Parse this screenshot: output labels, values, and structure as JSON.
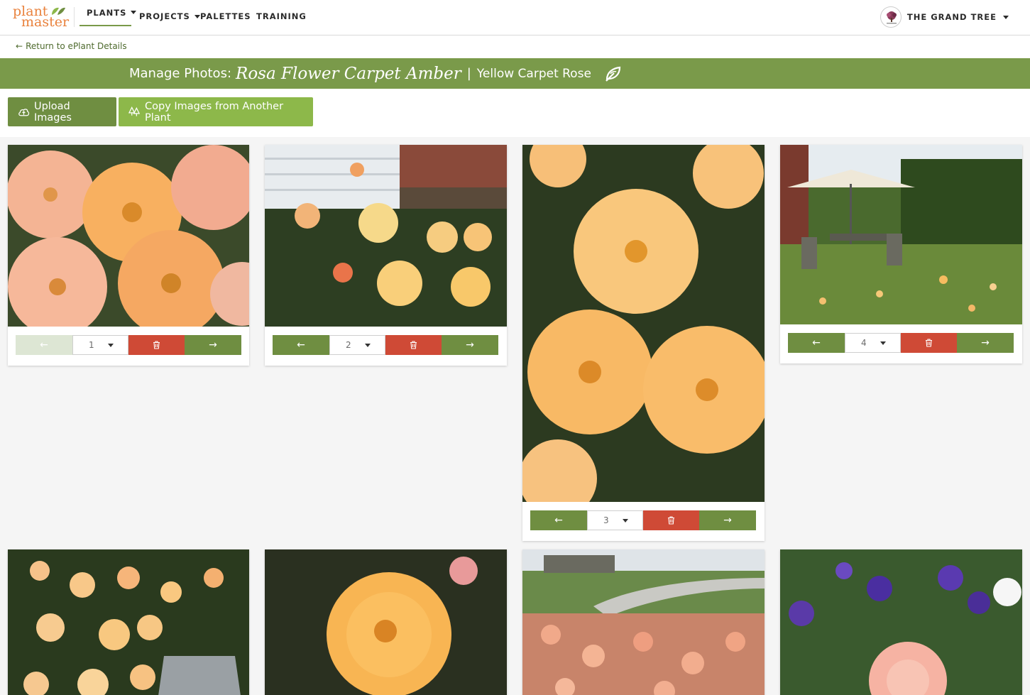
{
  "app": {
    "logo_line1": "plant",
    "logo_line2": "master"
  },
  "nav": {
    "items": [
      {
        "label": "PLANTS"
      },
      {
        "label": "PROJECTS"
      },
      {
        "label": "PALETTES"
      },
      {
        "label": "TRAINING"
      }
    ],
    "account_name": "THE GRAND TREE"
  },
  "back_link": "Return to ePlant Details",
  "header": {
    "prefix": "Manage Photos:",
    "botanical_name": "Rosa Flower Carpet Amber",
    "separator": "|",
    "common_name": "Yellow Carpet Rose"
  },
  "actions": {
    "upload_label": "Upload Images",
    "copy_label": "Copy Images from Another Plant"
  },
  "photos": [
    {
      "order": "1",
      "subject": "peach-orange roses close-up",
      "prev_enabled": false
    },
    {
      "order": "2",
      "subject": "roses in front of house",
      "prev_enabled": true
    },
    {
      "order": "3",
      "subject": "amber roses portrait",
      "prev_enabled": true
    },
    {
      "order": "4",
      "subject": "garden with patio umbrella",
      "prev_enabled": true
    },
    {
      "order": "",
      "subject": "roses with watering can"
    },
    {
      "order": "",
      "subject": "single amber rose"
    },
    {
      "order": "",
      "subject": "rose bed by driveway"
    },
    {
      "order": "",
      "subject": "pink rose with violas"
    }
  ],
  "colors": {
    "brand_green": "#7a9a4a",
    "button_green": "#6f8e41",
    "copy_green": "#8db84a",
    "delete_red": "#cf4a36",
    "logo_orange": "#e9823d"
  }
}
